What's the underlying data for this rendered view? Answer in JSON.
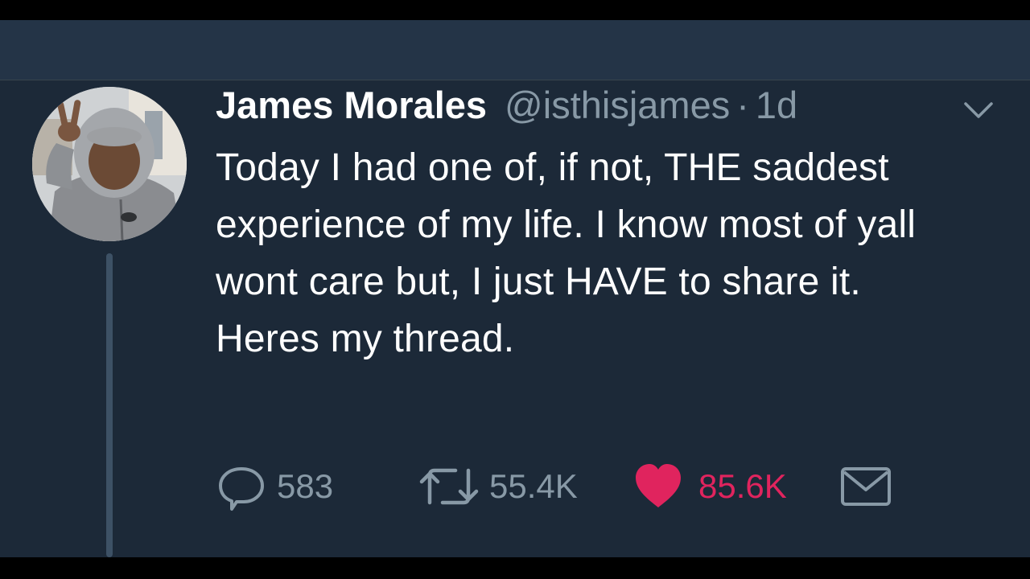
{
  "tweet": {
    "author_name": "James Morales",
    "handle": "@isthisjames",
    "separator": "·",
    "time": "1d",
    "text": "Today I had one of, if not, THE saddest experience of my life. I know most of yall wont care but, I just HAVE to share it. Heres my thread."
  },
  "actions": {
    "replies": "583",
    "retweets": "55.4K",
    "likes": "85.6K"
  },
  "icons": {
    "menu": "chevron-down-icon",
    "reply": "reply-icon",
    "retweet": "retweet-icon",
    "like": "heart-icon",
    "dm": "envelope-icon"
  },
  "colors": {
    "background": "#1c2938",
    "topbar": "#243447",
    "text": "#ffffff",
    "muted": "#8899a6",
    "like": "#e0245e"
  }
}
